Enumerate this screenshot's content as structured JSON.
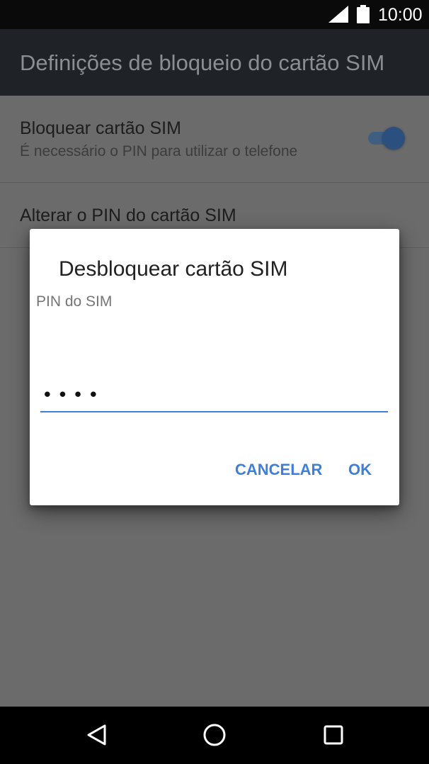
{
  "status_bar": {
    "time": "10:00",
    "icons": [
      "signal-icon",
      "battery-icon"
    ]
  },
  "app_bar": {
    "title": "Definições de bloqueio do cartão SIM"
  },
  "settings": {
    "lock_sim": {
      "title": "Bloquear cartão SIM",
      "subtitle": "É necessário o PIN para utilizar o telefone",
      "toggle_on": true
    },
    "change_pin": {
      "title": "Alterar o PIN do cartão SIM"
    }
  },
  "dialog": {
    "title": "Desbloquear cartão SIM",
    "field_label": "PIN do SIM",
    "pin_value": "••••",
    "cancel_label": "CANCELAR",
    "ok_label": "OK"
  },
  "nav_bar": {
    "icons": [
      "back-icon",
      "home-icon",
      "recents-icon"
    ]
  },
  "colors": {
    "accent": "#3f7fdc",
    "status_bar_bg": "#0a0a0a",
    "app_bar_bg": "#1f2328",
    "scrim_bg": "#6b6b6b",
    "dialog_bg": "#ffffff",
    "nav_bar_bg": "#000000"
  }
}
